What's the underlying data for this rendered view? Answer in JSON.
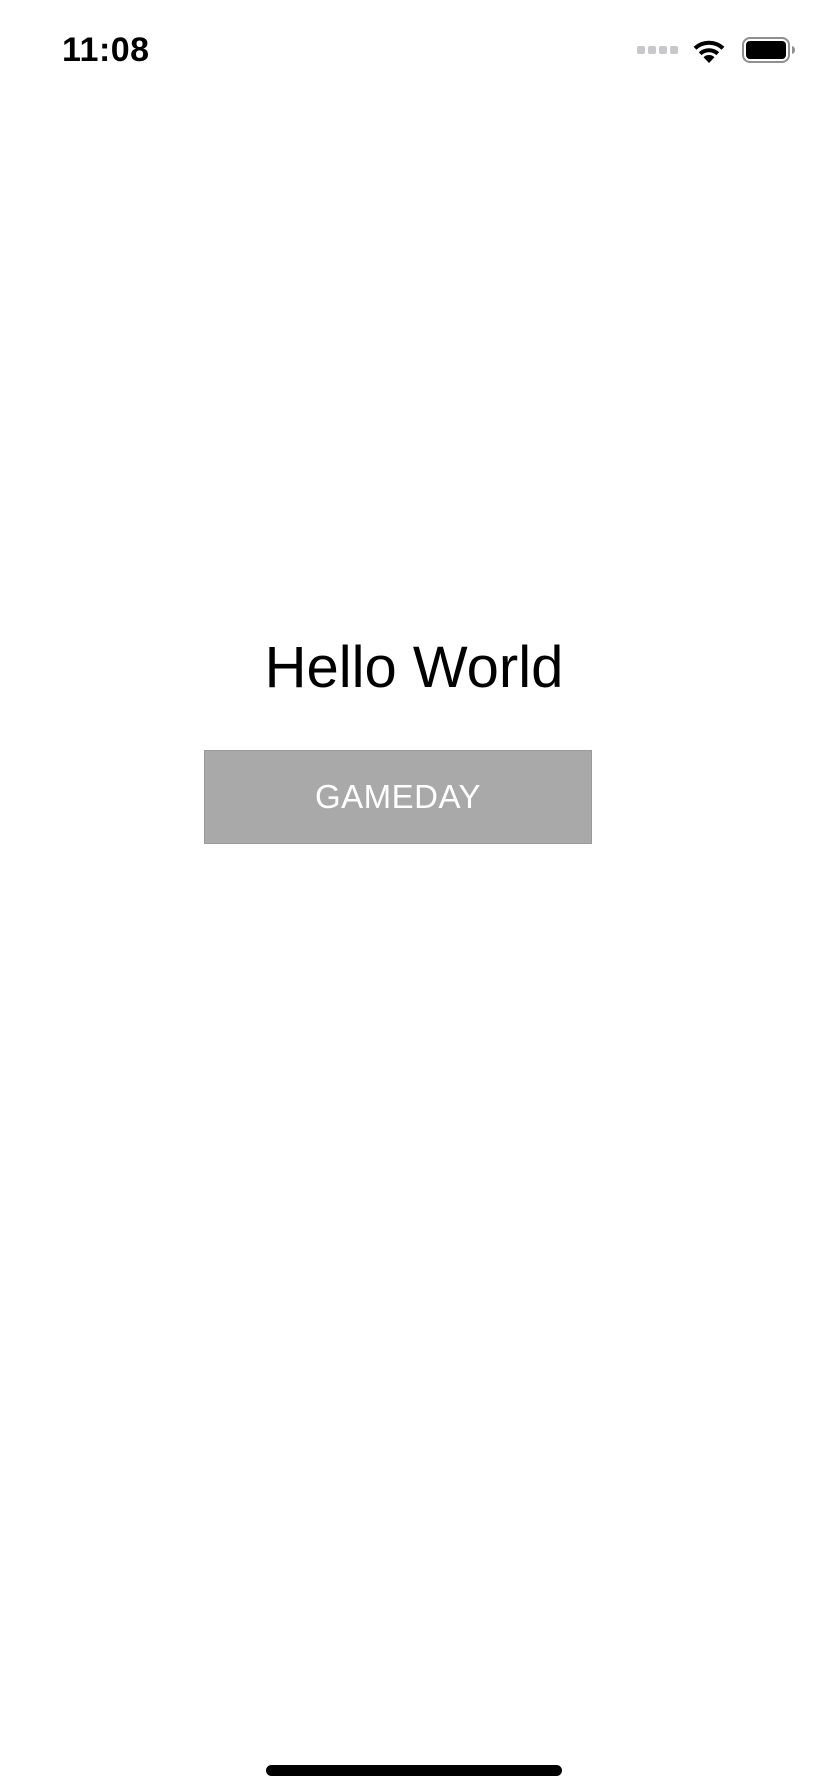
{
  "status_bar": {
    "time": "11:08"
  },
  "main": {
    "greeting": "Hello World",
    "button_label": "GAMEDAY"
  },
  "colors": {
    "button_background": "#a9a9a9",
    "button_text": "#ffffff",
    "text": "#000000",
    "background": "#ffffff"
  },
  "icons": [
    "cellular-signal-icon",
    "wifi-icon",
    "battery-icon"
  ]
}
